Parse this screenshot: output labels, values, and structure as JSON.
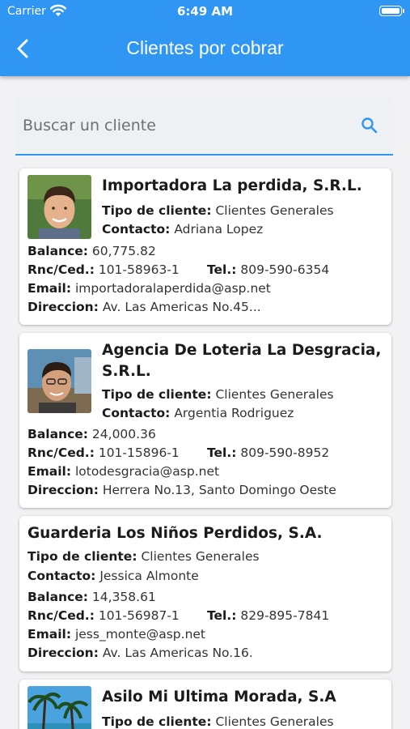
{
  "status_bar": {
    "carrier": "Carrier",
    "time": "6:49 AM"
  },
  "header": {
    "title": "Clientes por cobrar",
    "back_icon": "chevron-left-icon"
  },
  "search": {
    "placeholder": "Buscar un cliente",
    "value": "",
    "icon": "search-icon"
  },
  "labels": {
    "tipo": "Tipo de cliente:",
    "contacto": "Contacto:",
    "balance": "Balance:",
    "rnc": "Rnc/Ced.:",
    "tel": "Tel.:",
    "email": "Email:",
    "direccion": "Direccion:"
  },
  "clients": [
    {
      "name": "Importadora La perdida, S.R.L.",
      "tipo": "Clientes Generales",
      "contacto": "Adriana Lopez",
      "balance": "60,775.82",
      "rnc": "101-58963-1",
      "tel": "809-590-6354",
      "email": "importadoralaperdida@asp.net",
      "direccion": "Av. Las Americas No.45..."
    },
    {
      "name_line1": "Agencia De Loteria La Desgracia,",
      "name_line2": "S.R.L.",
      "tipo": "Clientes Generales",
      "contacto": "Argentia Rodriguez",
      "balance": "24,000.36",
      "rnc": "101-15896-1",
      "tel": "809-590-8952",
      "email": "lotodesgracia@asp.net",
      "direccion": "Herrera No.13, Santo Domingo Oeste"
    },
    {
      "name": "Guarderia Los Niños Perdidos, S.A.",
      "tipo": "Clientes Generales",
      "contacto": "Jessica Almonte",
      "balance": "14,358.61",
      "rnc": "101-56987-1",
      "tel": "829-895-7841",
      "email": "jess_monte@asp.net",
      "direccion": "Av. Las Americas No.16."
    },
    {
      "name": "Asilo Mi Ultima Morada, S.A",
      "tipo": "Clientes Generales"
    }
  ]
}
